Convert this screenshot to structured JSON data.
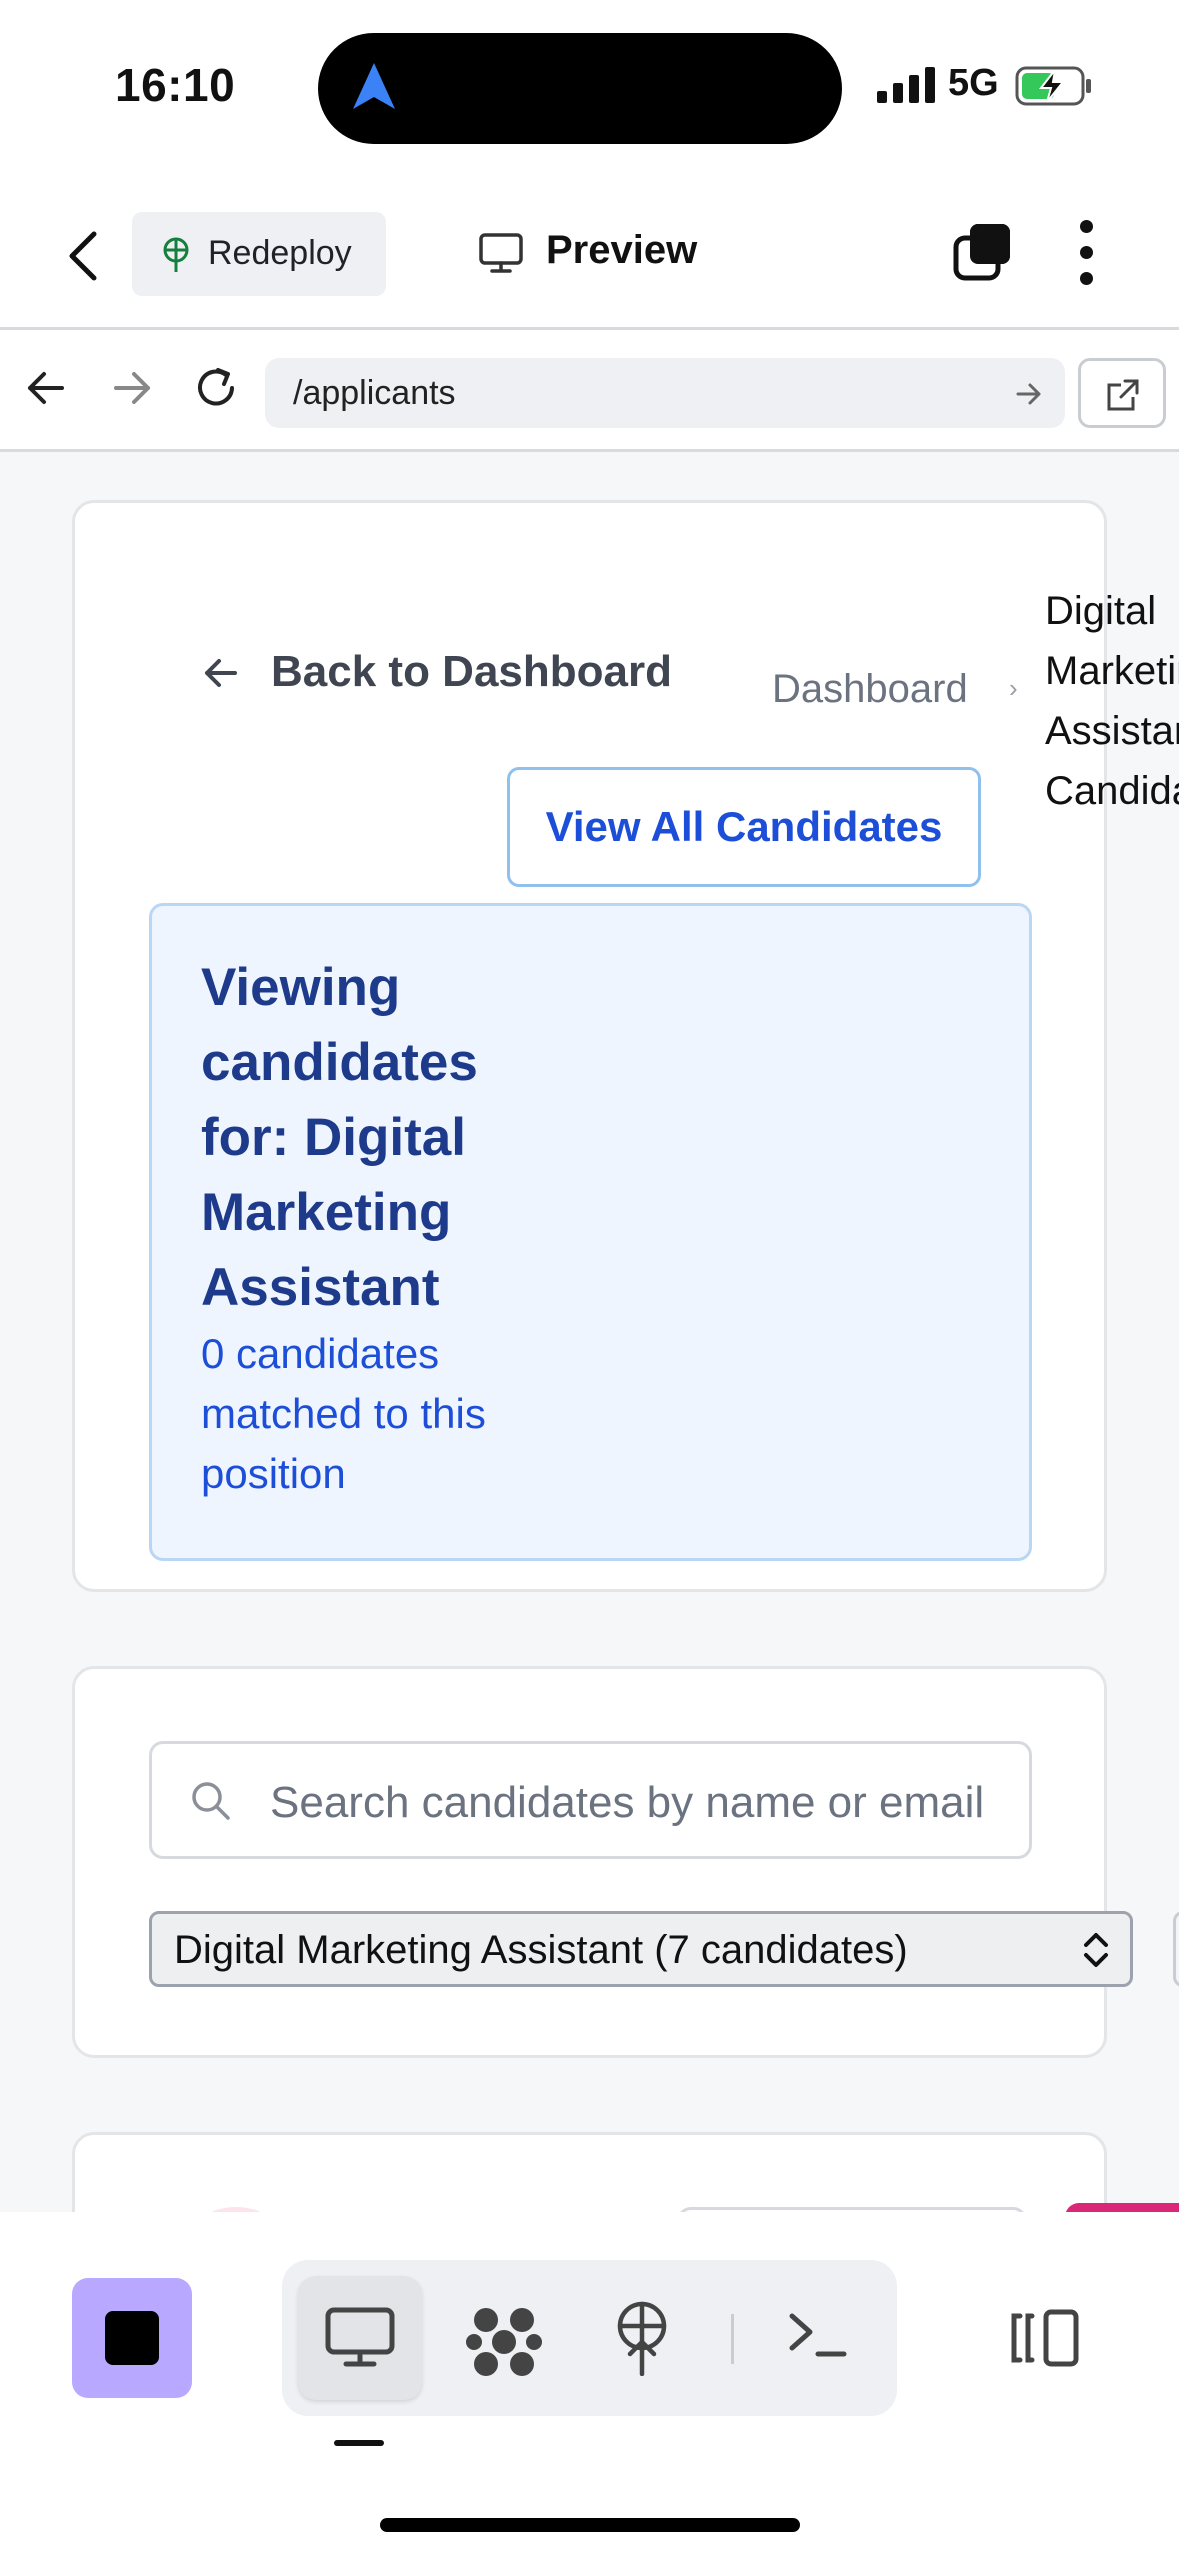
{
  "status_bar": {
    "time": "16:10",
    "network": "5G"
  },
  "toolbar": {
    "redeploy_label": "Redeploy",
    "preview_label": "Preview"
  },
  "browser": {
    "url": "/applicants"
  },
  "page": {
    "back_label": "Back to Dashboard",
    "breadcrumb": {
      "root": "Dashboard",
      "separator": "›",
      "current": "Digital Marketing Assistant Candidates"
    },
    "banner": {
      "title": "Viewing candidates for: Digital Marketing Assistant",
      "subtitle": "0 candidates matched to this position",
      "button": "View All Candidates"
    },
    "filters": {
      "search_placeholder": "Search candidates by name or email",
      "position_select": "Digital Marketing Assistant (7 candidates)"
    }
  },
  "colors": {
    "accent": "#1d4ed8",
    "banner_bg": "#eef5ff",
    "stop_button": "#b9a8ff",
    "tag": "#db2777"
  },
  "icons": {
    "redeploy": "antenna-icon",
    "preview": "monitor-icon",
    "tabs": "tabs-icon",
    "more": "more-vertical-icon",
    "search": "search-icon",
    "select": "chevron-up-down-icon"
  }
}
